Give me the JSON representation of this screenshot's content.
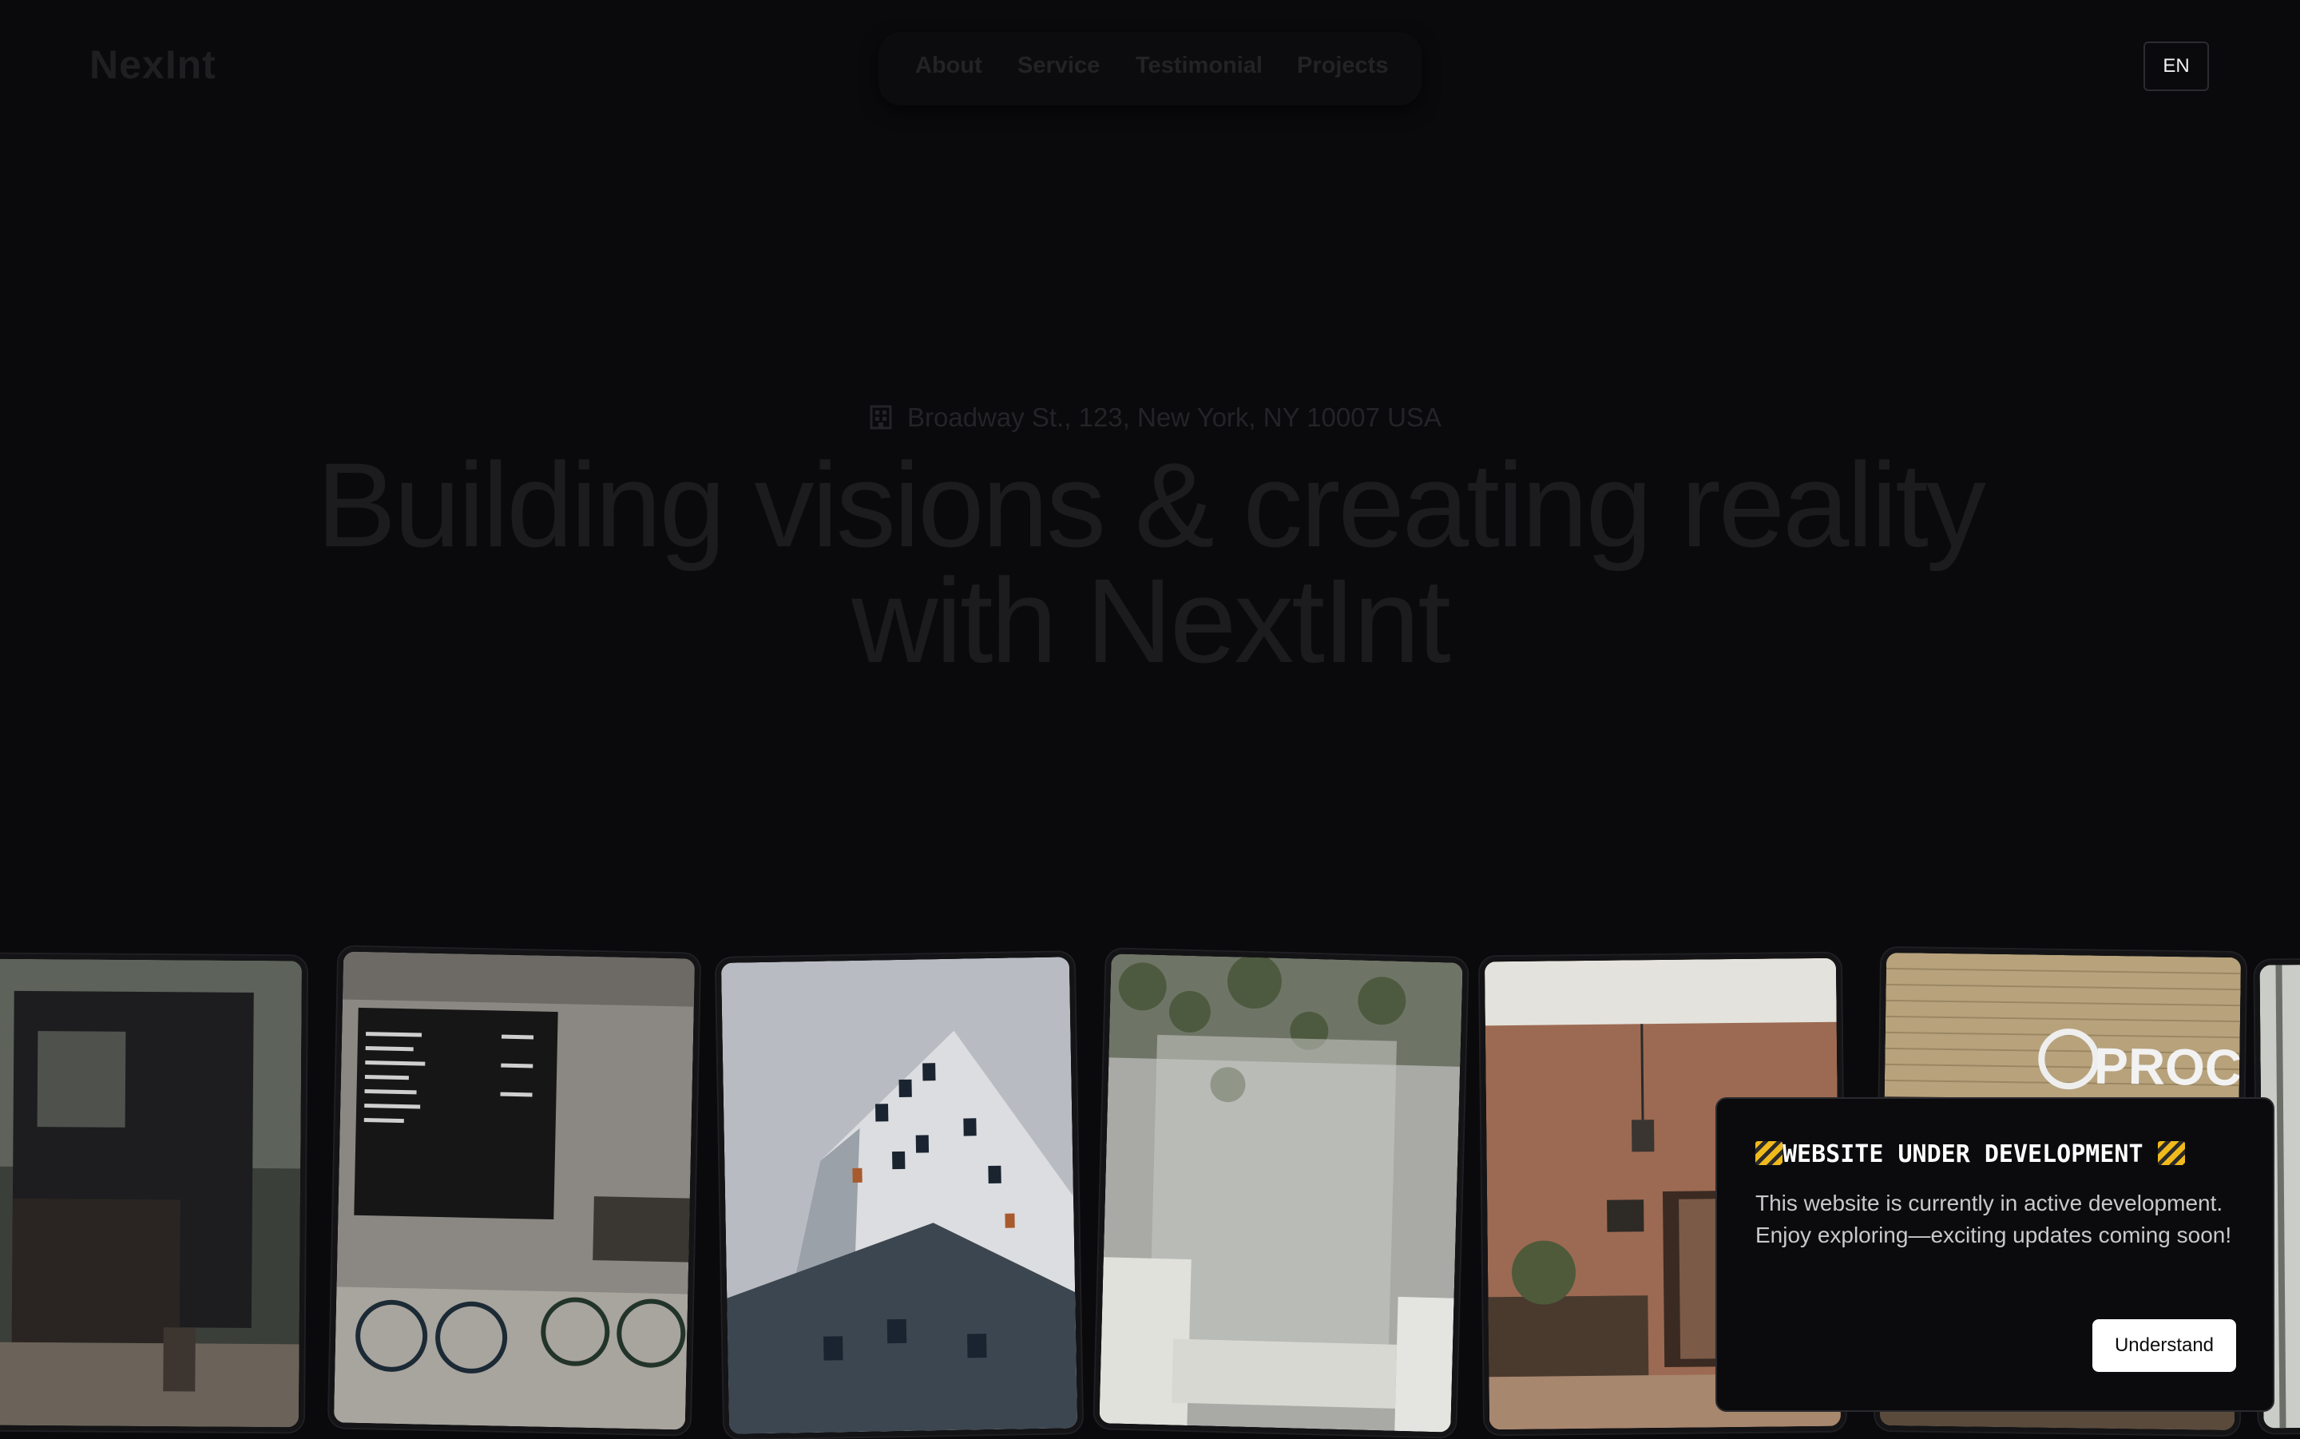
{
  "header": {
    "logo": "NexInt",
    "nav": [
      {
        "label": "About"
      },
      {
        "label": "Service"
      },
      {
        "label": "Testimonial"
      },
      {
        "label": "Projects"
      }
    ],
    "language": "EN"
  },
  "hero": {
    "address": "Broadway St., 123, New York, NY 10007 USA",
    "address_icon": "building-icon",
    "title_line1": "Building visions & creating reality",
    "title_line2": "with NextInt"
  },
  "gallery": {
    "photos": [
      {
        "subject": "dark-cabin-in-forest"
      },
      {
        "subject": "cafe-interior-with-bicycles"
      },
      {
        "subject": "modern-apartment-building"
      },
      {
        "subject": "marble-shower-with-plants"
      },
      {
        "subject": "terracotta-room-with-pendant-lamp"
      },
      {
        "subject": "brick-wall-signage"
      },
      {
        "subject": "forest-edge"
      }
    ],
    "sign_text": "PROC"
  },
  "dialog": {
    "title": "WEBSITE UNDER DEVELOPMENT",
    "message": "This website is currently in active development. Enjoy exploring—exciting updates coming soon!",
    "button": "Understand",
    "icon": "construction-barrier-icon"
  },
  "colors": {
    "background": "#0a0a0c",
    "dialog_background": "#0b0b0d",
    "button_background": "#ffffff"
  }
}
